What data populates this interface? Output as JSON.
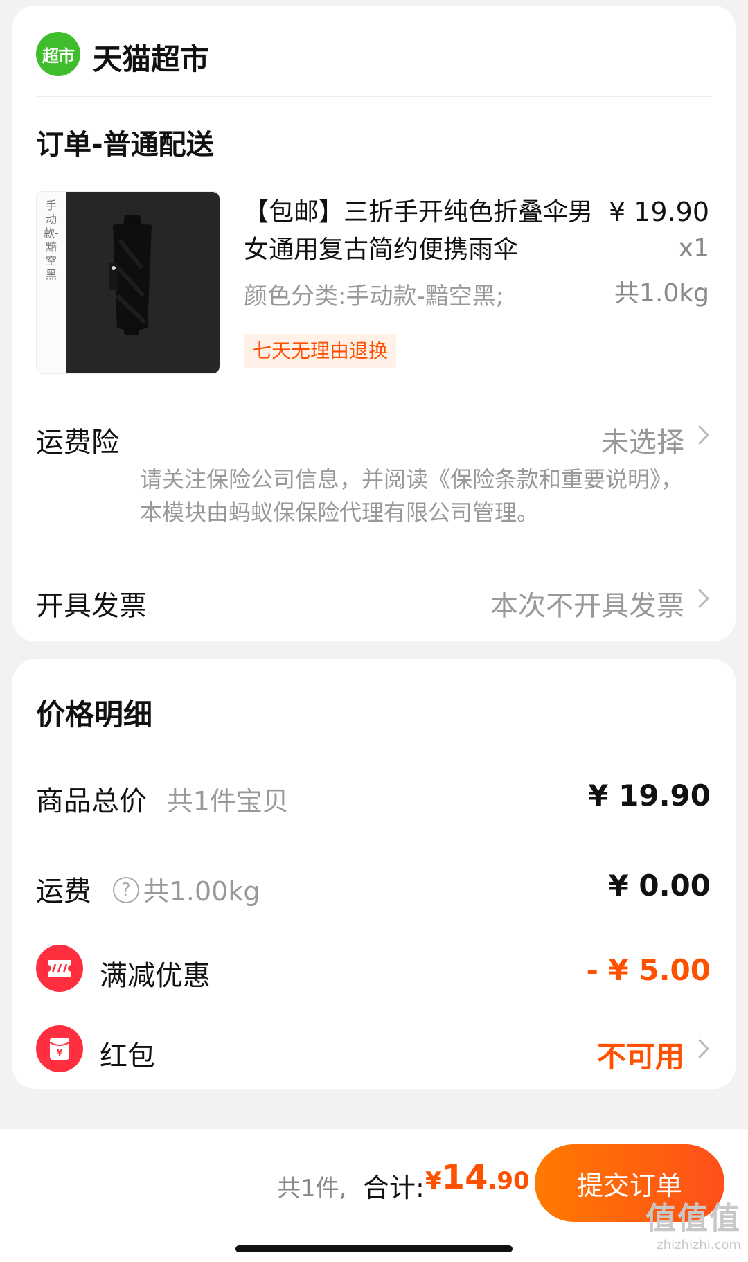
{
  "store": {
    "logo_text": "超市",
    "name": "天猫超市"
  },
  "order": {
    "title": "订单-普通配送",
    "product": {
      "image_side_text": "手动款-黯空黑",
      "title": "【包邮】三折手开纯色折叠伞男女通用复古简约便携雨伞",
      "price": "¥ 19.90",
      "quantity": "x1",
      "weight": "共1.0kg",
      "sku": "颜色分类:手动款-黯空黑;",
      "return_tag": "七天无理由退换"
    },
    "insurance": {
      "label": "运费险",
      "value": "未选择",
      "note": "请关注保险公司信息，并阅读《保险条款和重要说明》，本模块由蚂蚁保保险代理有限公司管理。"
    },
    "invoice": {
      "label": "开具发票",
      "value": "本次不开具发票"
    }
  },
  "price_detail": {
    "title": "价格明细",
    "goods_total": {
      "label": "商品总价",
      "sub": "共1件宝贝",
      "value": "¥ 19.90"
    },
    "shipping": {
      "label": "运费",
      "help_icon": "?",
      "sub": "共1.00kg",
      "value": "¥ 0.00"
    },
    "discount": {
      "label": "满减优惠",
      "value": "- ¥ 5.00"
    },
    "red_packet": {
      "label": "红包",
      "value": "不可用"
    }
  },
  "bottom": {
    "count": "共1件,",
    "total_label": "合计:",
    "currency": "¥",
    "total_int": "14",
    "total_dec": ".90",
    "submit_label": "提交订单"
  },
  "watermark": {
    "text": "值值值",
    "url": "zhizhizhi.com"
  },
  "colors": {
    "accent": "#ff5000",
    "logo_green": "#3fbd2c",
    "icon_red": "#ff2f3f"
  }
}
